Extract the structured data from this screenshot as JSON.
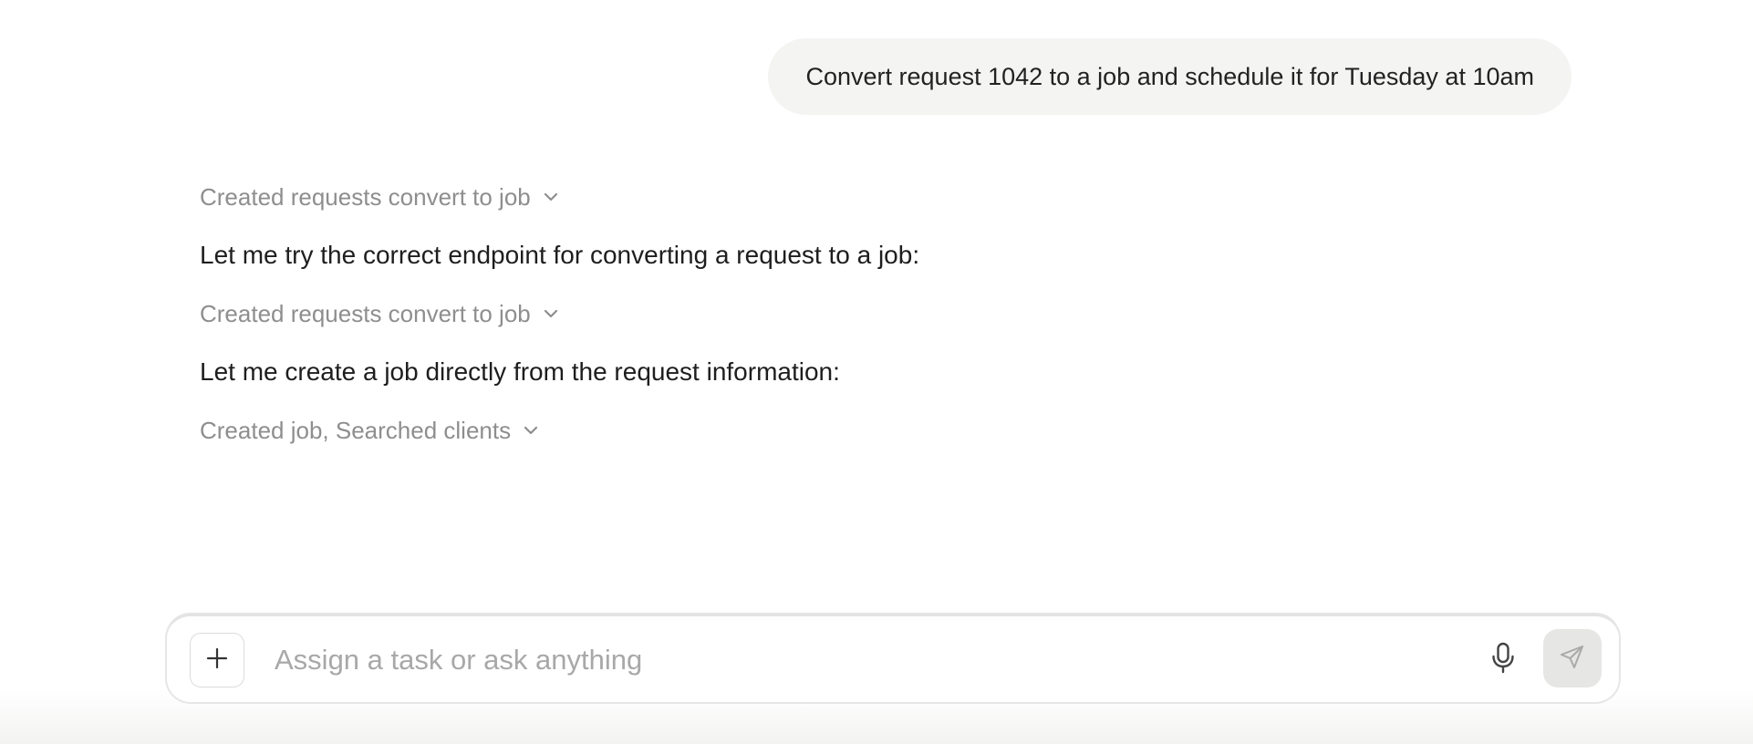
{
  "user_message": {
    "text": "Convert request 1042 to a job and schedule it for Tuesday at 10am"
  },
  "assistant": {
    "steps": [
      {
        "kind": "tool",
        "label": "Created requests convert to job",
        "icon": "chevron-down-icon"
      },
      {
        "kind": "text",
        "text": "Let me try the correct endpoint for converting a request to a job:"
      },
      {
        "kind": "tool",
        "label": "Created requests convert to job",
        "icon": "chevron-down-icon"
      },
      {
        "kind": "text",
        "text": "Let me create a job directly from the request information:"
      },
      {
        "kind": "tool",
        "label": "Created job, Searched clients",
        "icon": "chevron-down-icon"
      }
    ]
  },
  "composer": {
    "placeholder": "Assign a task or ask anything",
    "value": "",
    "add_icon": "plus-icon",
    "mic_icon": "microphone-icon",
    "send_icon": "send-icon"
  },
  "colors": {
    "user_bubble_bg": "#f4f4f3",
    "muted_text": "#8e8e8e",
    "body_text": "#1e1e1e",
    "send_button_bg": "#e6e6e4"
  }
}
